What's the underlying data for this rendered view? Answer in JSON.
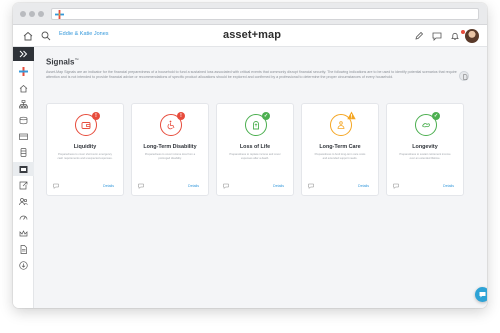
{
  "app": {
    "brand": "asset+map",
    "household": "Eddie & Katie Jones"
  },
  "page": {
    "title": "Signals",
    "title_sup": "™",
    "description": "Asset-Map Signals are an indicator for the financial preparedness of a household to fund a sustained loss associated with critical events that commonly disrupt financial security. The following indications are to be used to identify potential scenarios that require attention and is not intended to provide financial advice or recommendations of specific product allocations should be explored and confirmed by a professional to determine the proper circumstances of every household."
  },
  "cards": [
    {
      "title": "Liquidity",
      "badge": "!",
      "status": "risk",
      "color": "#e74c3c",
      "icon": "wallet-icon",
      "description": "Preparedness to cover short-term emergency cash requirements and unexpected expenses.",
      "details": "Details"
    },
    {
      "title": "Long-Term Disability",
      "badge": "!",
      "status": "risk",
      "color": "#e74c3c",
      "icon": "wheelchair-icon",
      "description": "Preparedness to cover income loss from a prolonged disability.",
      "details": "Details"
    },
    {
      "title": "Loss of Life",
      "badge": "✓",
      "status": "ok",
      "color": "#4caf50",
      "icon": "tombstone-icon",
      "description": "Preparedness to replace income and cover expenses after a death.",
      "details": "Details"
    },
    {
      "title": "Long-Term Care",
      "badge": "!",
      "status": "warning",
      "color": "#f5a623",
      "icon": "care-icon",
      "description": "Preparedness to fund long-term care costs and extended support needs.",
      "details": "Details"
    },
    {
      "title": "Longevity",
      "badge": "✓",
      "status": "ok",
      "color": "#4caf50",
      "icon": "hourglass-icon",
      "description": "Preparedness to sustain retirement income over an extended lifetime.",
      "details": "Details"
    }
  ],
  "colors": {
    "accent": "#3498db",
    "danger": "#e74c3c",
    "success": "#4caf50",
    "warning": "#f5a623"
  }
}
